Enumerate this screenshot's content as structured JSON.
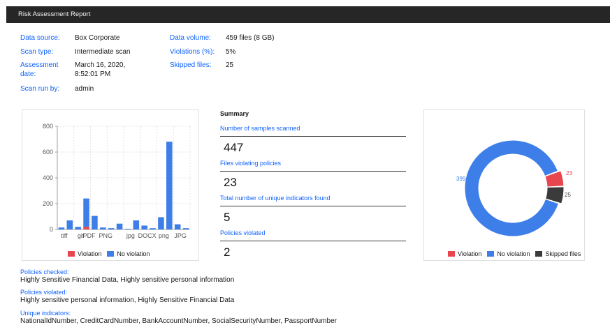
{
  "window": {
    "title": "Risk Assessment Report"
  },
  "meta_left": [
    {
      "key": "Data source:",
      "value": "Box Corporate"
    },
    {
      "key": "Scan type:",
      "value": "Intermediate scan"
    },
    {
      "key": "Assessment date:",
      "value": "March 16, 2020, 8:52:01 PM"
    },
    {
      "key": "Scan run by:",
      "value": "admin"
    }
  ],
  "meta_right": [
    {
      "key": "Data volume:",
      "value": "459 files (8 GB)"
    },
    {
      "key": "Violations (%):",
      "value": "5%"
    },
    {
      "key": "Skipped files:",
      "value": "25"
    }
  ],
  "summary": {
    "heading": "Summary",
    "rows": [
      {
        "label": "Number of samples scanned",
        "value": "447"
      },
      {
        "label": "Files violating policies",
        "value": "23"
      },
      {
        "label": "Total number of unique indicators found",
        "value": "5"
      },
      {
        "label": "Policies violated",
        "value": "2"
      }
    ]
  },
  "footer": [
    {
      "key": "Policies checked:",
      "value": "Highly Sensitive Financial Data, Highly sensitive personal information"
    },
    {
      "key": "Policies violated:",
      "value": "Highly sensitive personal information, Highly Sensitive Financial Data"
    },
    {
      "key": "Unique indicators:",
      "value": "NationalIdNumber, CreditCardNumber, BankAccountNumber, SocialSecurityNumber, PassportNumber"
    }
  ],
  "colors": {
    "violation": "#e8464f",
    "no_violation": "#3d7ee8",
    "skipped": "#3b3b3b",
    "accent": "#0f62fe",
    "titlebar": "#262626"
  },
  "chart_data": [
    {
      "type": "bar",
      "title": "",
      "xlabel": "",
      "ylabel": "",
      "ylim": [
        0,
        800
      ],
      "yticks": [
        0,
        200,
        400,
        600,
        800
      ],
      "categories": [
        "tiff",
        "",
        "gif",
        "PDF",
        "",
        "PNG",
        "",
        "",
        "jpg",
        "",
        "DOCX",
        "",
        "png",
        "",
        "JPG",
        ""
      ],
      "tick_labels_shown": [
        "tiff",
        "gif",
        "PDF",
        "PNG",
        "jpg",
        "DOCX",
        "png",
        "JPG"
      ],
      "series": [
        {
          "name": "Violation",
          "values": [
            0,
            0,
            0,
            20,
            0,
            0,
            0,
            0,
            0,
            0,
            0,
            0,
            0,
            0,
            0,
            0
          ]
        },
        {
          "name": "No violation",
          "values": [
            15,
            70,
            20,
            220,
            105,
            15,
            10,
            45,
            5,
            70,
            30,
            10,
            95,
            680,
            40,
            10
          ]
        }
      ],
      "legend": "bottom",
      "grid": true
    },
    {
      "type": "pie",
      "variant": "donut",
      "slices": [
        {
          "name": "Violation",
          "value": 23
        },
        {
          "name": "No violation",
          "value": 399
        },
        {
          "name": "Skipped files",
          "value": 25
        }
      ],
      "legend": "bottom"
    }
  ]
}
